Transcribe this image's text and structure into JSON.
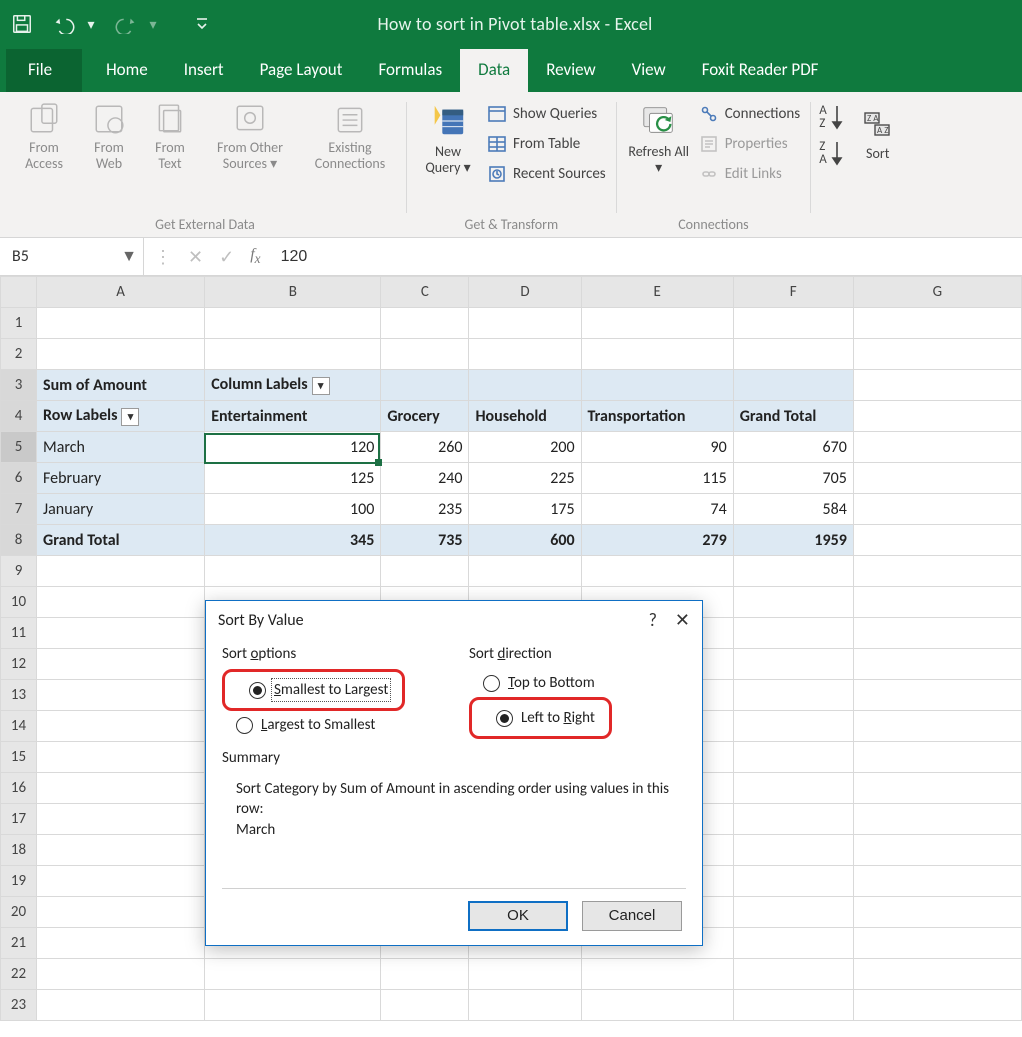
{
  "app": {
    "title": "How to sort in Pivot table.xlsx - Excel"
  },
  "tabs": [
    "File",
    "Home",
    "Insert",
    "Page Layout",
    "Formulas",
    "Data",
    "Review",
    "View",
    "Foxit Reader PDF"
  ],
  "activeTab": "Data",
  "ribbon": {
    "groups": {
      "external": {
        "label": "Get External Data",
        "fromAccess": "From Access",
        "fromWeb": "From Web",
        "fromText": "From Text",
        "fromOther": "From Other Sources",
        "existing": "Existing Connections"
      },
      "transform": {
        "label": "Get & Transform",
        "newQuery": "New Query",
        "showQueries": "Show Queries",
        "fromTable": "From Table",
        "recentSources": "Recent Sources"
      },
      "connections": {
        "label": "Connections",
        "refreshAll": "Refresh All",
        "connections": "Connections",
        "properties": "Properties",
        "editLinks": "Edit Links"
      },
      "sort": {
        "sort": "Sort"
      }
    }
  },
  "fbar": {
    "name": "B5",
    "value": "120"
  },
  "cols": [
    "A",
    "B",
    "C",
    "D",
    "E",
    "F",
    "G"
  ],
  "pivot": {
    "sumOf": "Sum of Amount",
    "colLabels": "Column Labels",
    "rowLabels": "Row Labels",
    "cats": [
      "Entertainment",
      "Grocery",
      "Household",
      "Transportation",
      "Grand Total"
    ],
    "rows": [
      {
        "label": "March",
        "v": [
          120,
          260,
          200,
          90,
          670
        ]
      },
      {
        "label": "February",
        "v": [
          125,
          240,
          225,
          115,
          705
        ]
      },
      {
        "label": "January",
        "v": [
          100,
          235,
          175,
          74,
          584
        ]
      }
    ],
    "grand": {
      "label": "Grand Total",
      "v": [
        345,
        735,
        600,
        279,
        1959
      ]
    }
  },
  "dialog": {
    "title": "Sort By Value",
    "sortOptionsLabel": "Sort options",
    "opt1": "Smallest to Largest",
    "opt2": "Largest to Smallest",
    "sortDirLabel": "Sort direction",
    "dir1": "Top to Bottom",
    "dir2": "Left to Right",
    "summaryLabel": "Summary",
    "summaryText": "Sort Category by Sum of Amount in ascending order using values in this row:\nMarch",
    "ok": "OK",
    "cancel": "Cancel"
  },
  "chart_data": {
    "type": "table",
    "title": "Sum of Amount",
    "columns": [
      "Entertainment",
      "Grocery",
      "Household",
      "Transportation",
      "Grand Total"
    ],
    "rows": [
      "March",
      "February",
      "January",
      "Grand Total"
    ],
    "values": [
      [
        120,
        260,
        200,
        90,
        670
      ],
      [
        125,
        240,
        225,
        115,
        705
      ],
      [
        100,
        235,
        175,
        74,
        584
      ],
      [
        345,
        735,
        600,
        279,
        1959
      ]
    ]
  }
}
